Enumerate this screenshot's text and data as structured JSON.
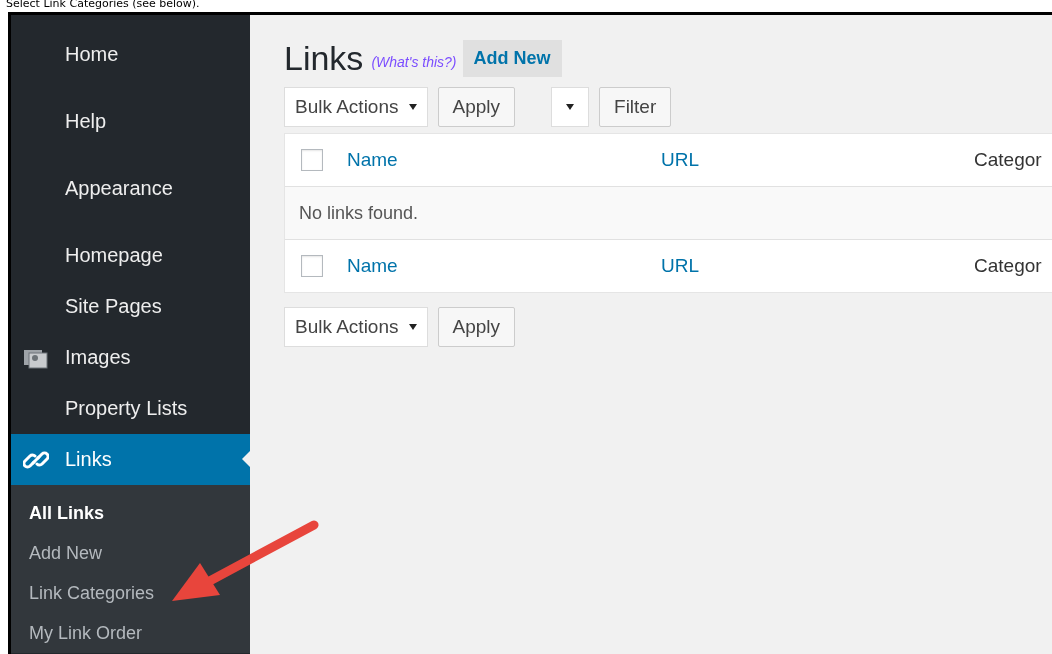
{
  "caption": "Select Link Categories (see below).",
  "sidebar": {
    "groups": [
      [
        {
          "label": "Home",
          "kind": "plain",
          "selected": false
        }
      ],
      [
        {
          "label": "Help",
          "kind": "plain",
          "selected": false
        }
      ],
      [
        {
          "label": "Appearance",
          "kind": "plain",
          "selected": false
        }
      ],
      [
        {
          "label": "Homepage",
          "kind": "plain",
          "selected": false
        },
        {
          "label": "Site Pages",
          "kind": "plain",
          "selected": false
        },
        {
          "label": "Images",
          "kind": "images",
          "selected": false
        },
        {
          "label": "Property Lists",
          "kind": "plain",
          "selected": false
        },
        {
          "label": "Links",
          "kind": "link",
          "selected": true
        }
      ]
    ],
    "submenu": [
      {
        "label": "All Links",
        "selected": true
      },
      {
        "label": "Add New",
        "selected": false
      },
      {
        "label": "Link Categories",
        "selected": false
      },
      {
        "label": "My Link Order",
        "selected": false
      }
    ]
  },
  "page": {
    "title": "Links",
    "help_link": "(What's this?)",
    "add_new": "Add New"
  },
  "top_actions": {
    "bulk_actions": "Bulk Actions",
    "apply": "Apply",
    "filter": "Filter"
  },
  "table": {
    "header_columns": [
      "Name",
      "URL",
      "Categor"
    ],
    "footer_columns": [
      "Name",
      "URL",
      "Categor"
    ],
    "header_checked": false,
    "footer_checked": false,
    "empty_message": "No links found."
  },
  "bottom_actions": {
    "bulk_actions": "Bulk Actions",
    "apply": "Apply"
  }
}
